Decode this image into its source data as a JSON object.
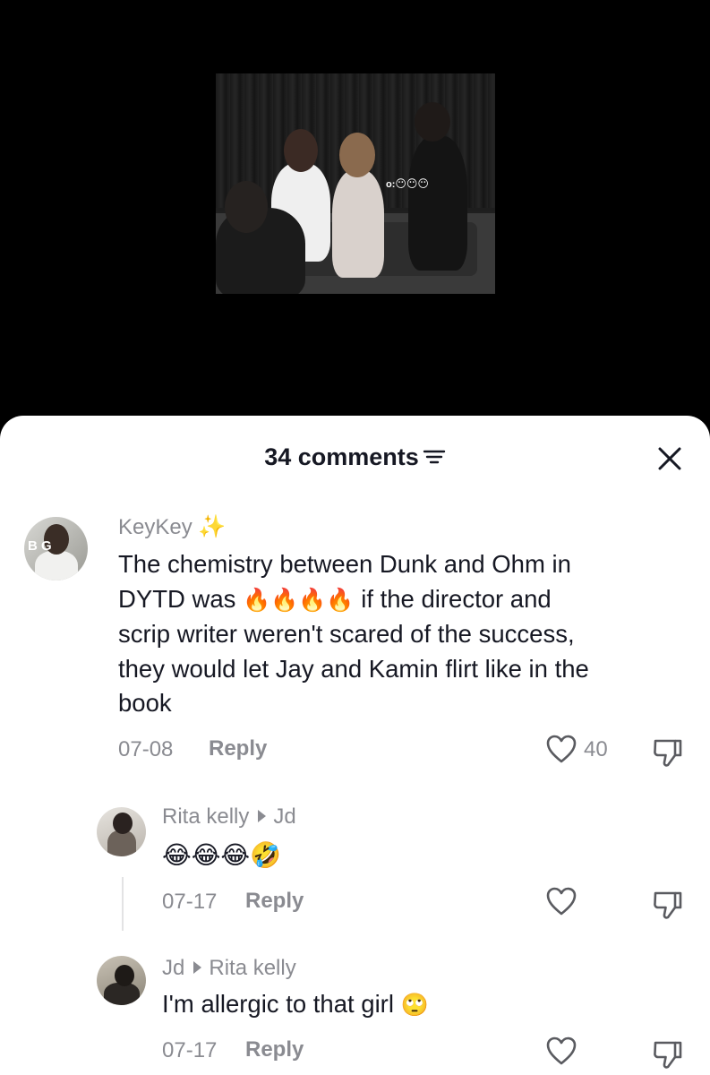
{
  "video": {
    "overlay_caption": "o:"
  },
  "comments_sheet": {
    "count_label": "34 comments",
    "icons": {
      "filter": "filter-lines-icon",
      "close": "close-icon"
    }
  },
  "comments": [
    {
      "username": "KeyKey",
      "username_badge": "✨",
      "avatar_lettering": "B G",
      "text_line1": "The chemistry between Dunk and Ohm in",
      "text_line2_start": "DYTD was ",
      "text_line2_emoji": "🔥🔥🔥🔥",
      "text_line2_end": " if the director and",
      "text_line3": "scrip writer weren't scared of the success,",
      "text_line4": "they would let Jay and Kamin flirt like in the",
      "text_line5": "book",
      "date": "07-08",
      "reply_label": "Reply",
      "like_count": "40"
    },
    {
      "username": "Rita kelly",
      "reply_to": "Jd",
      "text": "😂😂😂🤣",
      "date": "07-17",
      "reply_label": "Reply",
      "like_count": ""
    },
    {
      "username": "Jd",
      "reply_to": "Rita kelly",
      "text": "I'm allergic to that girl ",
      "text_emoji": "🙄",
      "date": "07-17",
      "reply_label": "Reply",
      "like_count": ""
    }
  ]
}
